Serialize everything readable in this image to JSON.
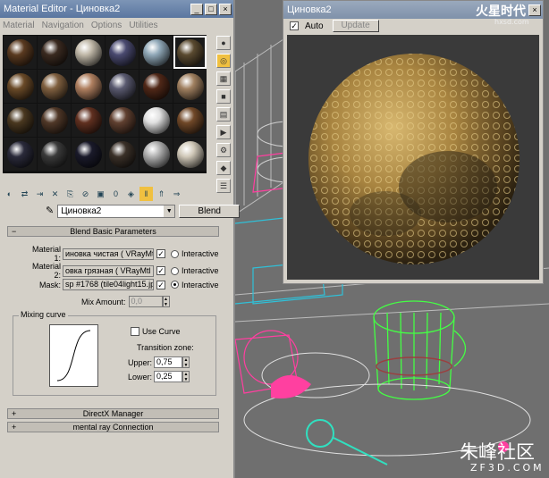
{
  "material_editor": {
    "title": "Material Editor - Циновка2",
    "menu": [
      "Material",
      "Navigation",
      "Options",
      "Utilities"
    ],
    "material_name": "Циновка2",
    "type_button": "Blend",
    "slot_colors": [
      "#5a3a20",
      "#3a2a20",
      "#c0b8a8",
      "#4a4a70",
      "#90a8b8",
      "#5a4a30",
      "#6a4a28",
      "#806040",
      "#b08060",
      "#5a5a70",
      "#502818",
      "#a08060",
      "#4a3820",
      "#503828",
      "#603020",
      "#604030",
      "#e0e0e0",
      "#704828",
      "#2a2a3a",
      "#3a3a3a",
      "#1a1a2a",
      "#3a3028",
      "#b0b0b0",
      "#d0c8b8"
    ],
    "blend_rollout": {
      "title": "Blend Basic Parameters",
      "material1_label": "Material 1:",
      "material1_value": "иновка чистая  ( VRayMtl )",
      "material2_label": "Material 2:",
      "material2_value": "овка грязная  ( VRayMtl )",
      "mask_label": "Mask:",
      "mask_value": "sp #1768 (tile04light15.jpg)",
      "interactive": "Interactive",
      "mix_amount_label": "Mix Amount:",
      "mix_amount_value": "0,0",
      "mixing_curve_label": "Mixing curve",
      "use_curve_label": "Use Curve",
      "transition_zone_label": "Transition zone:",
      "upper_label": "Upper:",
      "upper_value": "0,75",
      "lower_label": "Lower:",
      "lower_value": "0,25"
    },
    "directx_rollout": "DirectX Manager",
    "mental_ray_rollout": "mental ray Connection"
  },
  "render_window": {
    "title": "Циновка2",
    "auto_label": "Auto",
    "update_label": "Update"
  },
  "watermark": {
    "top_logo": "火星时代",
    "top_url": "hxsd.com",
    "bottom_logo": "朱峰社区",
    "bottom_url": "ZF3D.COM"
  }
}
